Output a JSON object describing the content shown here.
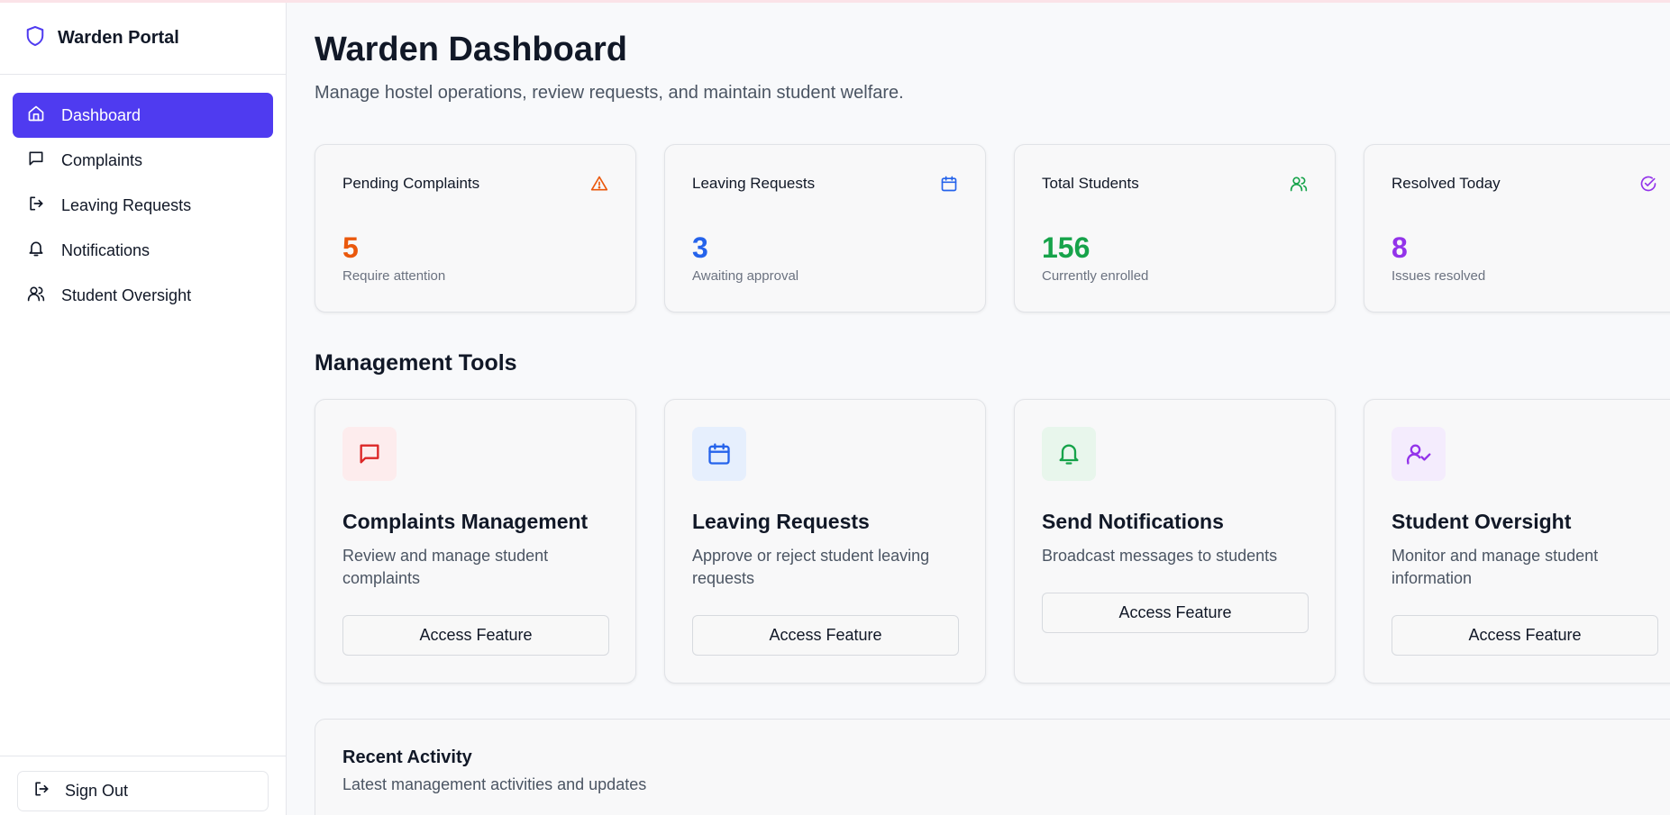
{
  "app": {
    "title": "Warden Portal"
  },
  "sidebar": {
    "items": [
      {
        "label": "Dashboard",
        "icon": "home-icon",
        "active": true
      },
      {
        "label": "Complaints",
        "icon": "message-square-icon"
      },
      {
        "label": "Leaving Requests",
        "icon": "log-out-icon"
      },
      {
        "label": "Notifications",
        "icon": "bell-icon"
      },
      {
        "label": "Student Oversight",
        "icon": "users-icon"
      }
    ],
    "sign_out": "Sign Out"
  },
  "header": {
    "title": "Warden Dashboard",
    "subtitle": "Manage hostel operations, review requests, and maintain student welfare."
  },
  "stats": [
    {
      "label": "Pending Complaints",
      "value": "5",
      "caption": "Require attention",
      "color": "#ea580c",
      "icon": "alert-triangle-icon"
    },
    {
      "label": "Leaving Requests",
      "value": "3",
      "caption": "Awaiting approval",
      "color": "#2563eb",
      "icon": "calendar-icon"
    },
    {
      "label": "Total Students",
      "value": "156",
      "caption": "Currently enrolled",
      "color": "#16a34a",
      "icon": "users-icon"
    },
    {
      "label": "Resolved Today",
      "value": "8",
      "caption": "Issues resolved",
      "color": "#9333ea",
      "icon": "check-circle-icon"
    }
  ],
  "tools": {
    "title": "Management Tools",
    "items": [
      {
        "title": "Complaints Management",
        "description": "Review and manage student complaints",
        "button": "Access Feature",
        "icon": "message-square-icon",
        "color": "#dc2626",
        "tile": "#fdeced"
      },
      {
        "title": "Leaving Requests",
        "description": "Approve or reject student leaving requests",
        "button": "Access Feature",
        "icon": "calendar-icon",
        "color": "#2563eb",
        "tile": "#e6effd"
      },
      {
        "title": "Send Notifications",
        "description": "Broadcast messages to students",
        "button": "Access Feature",
        "icon": "bell-icon",
        "color": "#16a34a",
        "tile": "#e8f6ec"
      },
      {
        "title": "Student Oversight",
        "description": "Monitor and manage student information",
        "button": "Access Feature",
        "icon": "user-check-icon",
        "color": "#9333ea",
        "tile": "#f4ecfd"
      }
    ]
  },
  "activity": {
    "title": "Recent Activity",
    "subtitle": "Latest management activities and updates"
  },
  "colors": {
    "accent": "#4f3bf0",
    "brand_icon": "#4f3bf0"
  }
}
